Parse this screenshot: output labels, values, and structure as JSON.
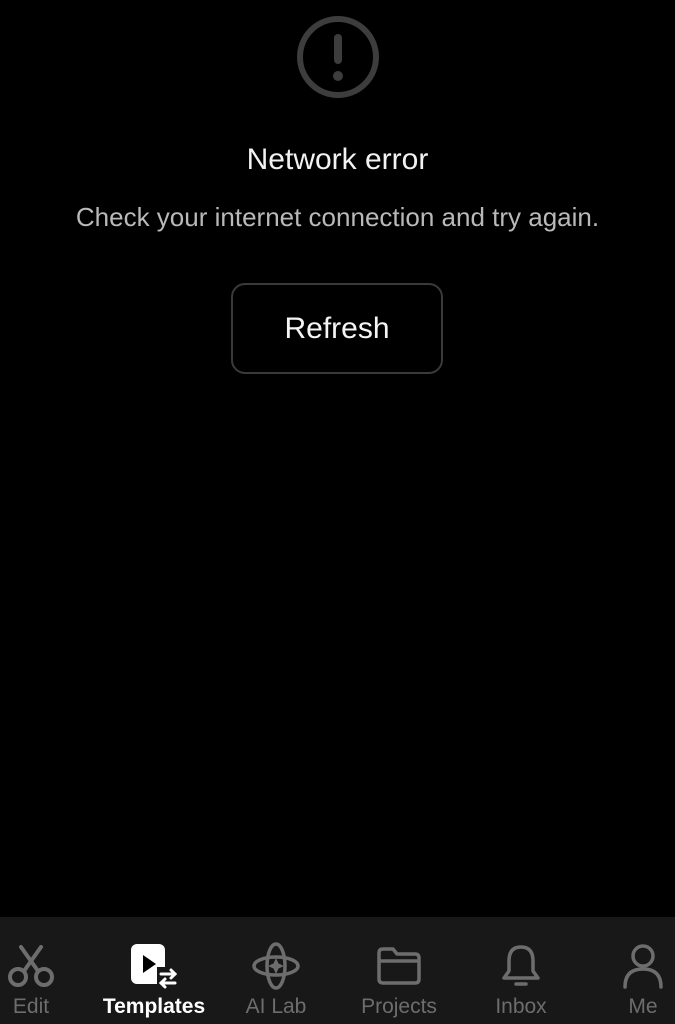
{
  "error": {
    "icon": "exclamation-circle-icon",
    "title": "Network error",
    "message": "Check your internet connection and try again.",
    "refresh_label": "Refresh"
  },
  "tab_bar": {
    "active_tab": "Templates",
    "items": [
      {
        "label": "Edit",
        "icon": "scissors-icon"
      },
      {
        "label": "Templates",
        "icon": "templates-icon"
      },
      {
        "label": "AI Lab",
        "icon": "ai-lab-icon"
      },
      {
        "label": "Projects",
        "icon": "folder-icon"
      },
      {
        "label": "Inbox",
        "icon": "bell-icon"
      },
      {
        "label": "Me",
        "icon": "person-icon"
      }
    ]
  },
  "colors": {
    "background": "#000000",
    "tab_bar_background": "#181818",
    "active_tab": "#ffffff",
    "inactive_tab": "#6d6d6d",
    "title_text": "#f2f2f2",
    "message_text": "#b9b9b9",
    "icon_muted": "#3d3d3d"
  }
}
